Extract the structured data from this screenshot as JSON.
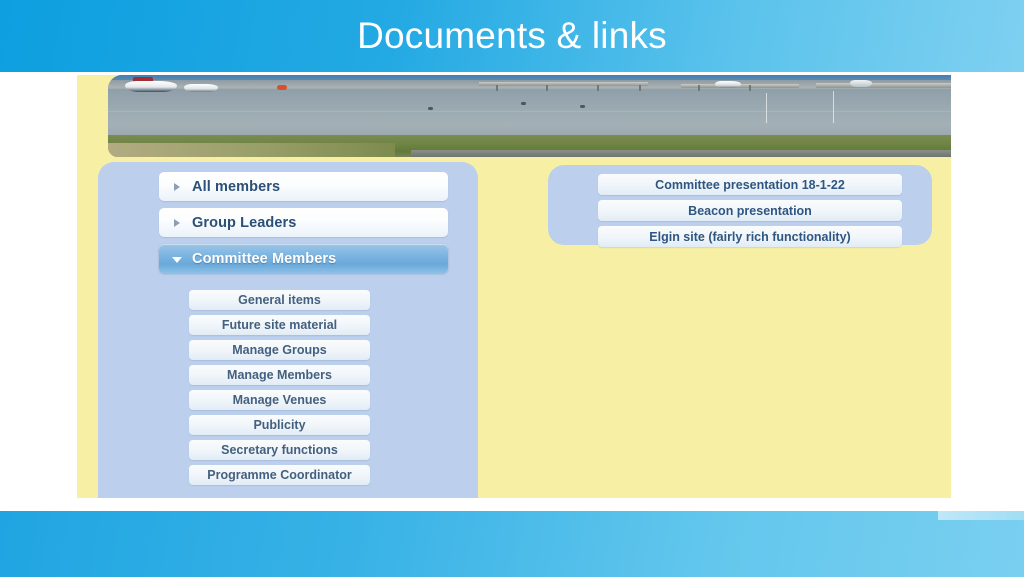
{
  "slide": {
    "title": "Documents & links",
    "header_color": "#23a9e3",
    "footer_color": "#4fbce9",
    "page_background": "#f7f0a4",
    "panel_color": "#bcd0ee"
  },
  "banner": {
    "alt": "harbour-marina-photo"
  },
  "nav": {
    "items": [
      {
        "label": "All members",
        "selected": false,
        "caret": "chevron-right-icon"
      },
      {
        "label": "Group Leaders",
        "selected": false,
        "caret": "chevron-right-icon"
      },
      {
        "label": "Committee Members",
        "selected": true,
        "caret": "chevron-down-icon"
      }
    ],
    "submenu": [
      {
        "label": "General items"
      },
      {
        "label": "Future site material"
      },
      {
        "label": "Manage Groups"
      },
      {
        "label": "Manage Members"
      },
      {
        "label": "Manage Venues"
      },
      {
        "label": "Publicity"
      },
      {
        "label": "Secretary functions"
      },
      {
        "label": "Programme Coordinator"
      }
    ]
  },
  "links": {
    "items": [
      {
        "label": "Committee presentation 18-1-22"
      },
      {
        "label": "Beacon presentation"
      },
      {
        "label": "Elgin site (fairly rich functionality)"
      }
    ]
  }
}
